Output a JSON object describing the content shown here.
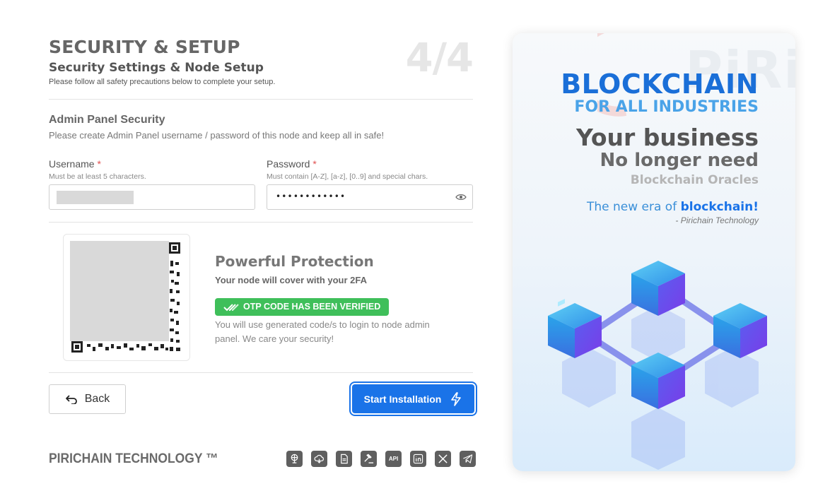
{
  "header": {
    "title": "SECURITY & SETUP",
    "subtitle": "Security Settings & Node Setup",
    "description": "Please follow all safety precautions below to complete your setup.",
    "step": "4/4"
  },
  "admin_security": {
    "title": "Admin Panel Security",
    "description": "Please create Admin Panel username / password of this node and keep all in safe!",
    "username": {
      "label": "Username",
      "required_mark": "*",
      "hint": "Must be at least 5 characters."
    },
    "password": {
      "label": "Password",
      "required_mark": "*",
      "hint": "Must contain [A-Z], [a-z], [0..9] and special chars.",
      "value_masked": "••••••••••••"
    }
  },
  "protection": {
    "title": "Powerful Protection",
    "subtitle": "Your node will cover with your 2FA",
    "badge": "OTP CODE HAS BEEN VERIFIED",
    "description": "You will use generated code/s to login to node admin panel. We care your security!"
  },
  "buttons": {
    "back": "Back",
    "start": "Start Installation"
  },
  "footer": {
    "brand": "PIRICHAIN TECHNOLOGY ™",
    "social": [
      "globe-icon",
      "cloud-icon",
      "document-icon",
      "gavel-icon",
      "API",
      "linkedin-icon",
      "x-icon",
      "telegram-icon"
    ],
    "api_label": "API"
  },
  "promo": {
    "watermark": "PiRi",
    "headline": "BLOCKCHAIN",
    "subheadline": "FOR ALL INDUSTRIES",
    "line1": "Your business",
    "line2": "No longer need",
    "line3": "Blockchain Oracles",
    "quote_pre": "The new era of ",
    "quote_em": "blockchain!",
    "quote_author": "- Pirichain Technology"
  },
  "colors": {
    "accent": "#1a73e8",
    "success": "#3fbf5a",
    "required": "#e05050"
  }
}
